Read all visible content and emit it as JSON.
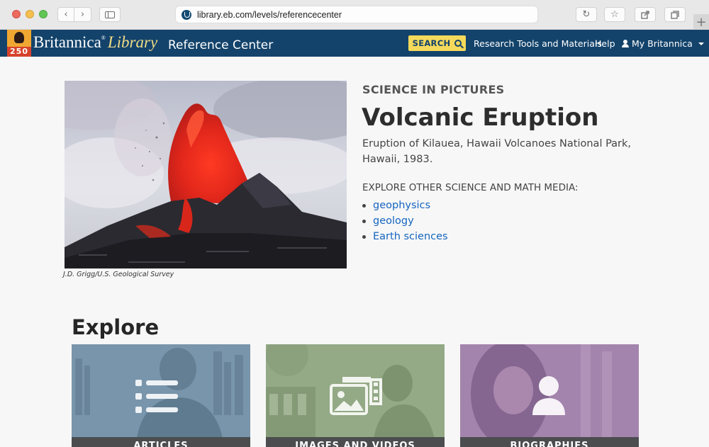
{
  "browser": {
    "url": "library.eb.com/levels/referencecenter",
    "icons": [
      "back-icon",
      "forward-icon",
      "sidebar-icon",
      "reload-icon",
      "star-icon",
      "share-icon",
      "tabs-icon",
      "plus-icon"
    ]
  },
  "header": {
    "logo_number": "250",
    "brand_name": "Britannica",
    "brand_reg": "®",
    "brand_library": "Library",
    "brand_section": "Reference Center",
    "search_label": "SEARCH",
    "nav": {
      "research": "Research Tools and Materials",
      "help": "Help",
      "my_account": "My Britannica"
    },
    "colors": {
      "bar": "#13436b",
      "search": "#f5d95b",
      "library": "#f2dc86"
    }
  },
  "feature": {
    "photo_credit": "J.D. Grigg/U.S. Geological Survey",
    "kicker": "SCIENCE IN PICTURES",
    "title": "Volcanic Eruption",
    "caption": "Eruption of Kilauea, Hawaii Volcanoes National Park, Hawaii, 1983.",
    "explore_heading": "EXPLORE OTHER SCIENCE AND MATH MEDIA:",
    "topics": [
      "geophysics",
      "geology",
      "Earth sciences"
    ]
  },
  "explore": {
    "heading": "Explore",
    "cards": [
      {
        "label": "ARTICLES",
        "icon": "list-icon",
        "color": "#7995ab"
      },
      {
        "label": "IMAGES AND VIDEOS",
        "icon": "media-icon",
        "color": "#94a986"
      },
      {
        "label": "BIOGRAPHIES",
        "icon": "person-icon",
        "color": "#a384ad"
      }
    ]
  }
}
